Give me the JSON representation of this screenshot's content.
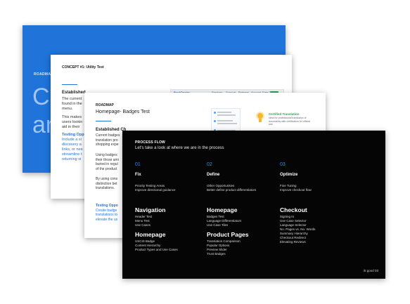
{
  "slide1": {
    "label": "ROADMAP",
    "big_line1": "Cu",
    "big_line2": "an"
  },
  "slide2": {
    "title": "CONCEPT #1: Utility Test",
    "heading": "Established",
    "para1": [
      "The current",
      "found in the",
      "menu."
    ],
    "para2": [
      "This makes",
      "users lookin",
      "aid in their"
    ],
    "testing_label": "Testing Opp",
    "testing_lines": [
      "Include a si",
      "discovery a",
      "links, or nee",
      "streamline t",
      "returning vi"
    ],
    "nav": {
      "logo": "BookDoctor",
      "items": [
        "Services",
        "Support",
        "Partners",
        "Account"
      ],
      "quote": "Free Quote"
    }
  },
  "slide3": {
    "label": "ROADMAP",
    "title": "Homepage- Badges Test",
    "heading": "Established Ch",
    "para1": [
      "Current badges",
      "translation pro",
      "shopping expe"
    ],
    "para2": [
      "Using badges",
      "their those ami",
      "buried in regul",
      "of the product"
    ],
    "para3": [
      "By using cons",
      "distinction bet",
      "translations."
    ],
    "testing_label": "Testing Oppo",
    "testing_lines": [
      "Create badge",
      "translations to",
      "elevate the us"
    ],
    "cert_title": "Certified Translation",
    "cert_desc": "Ideal for professional translation of documents with certification for official use."
  },
  "slide4": {
    "label": "PROCESS FLOW",
    "subtitle": "Let's take a look at where we are in the process",
    "columns": [
      {
        "num": "01",
        "title": "Fix",
        "lines": [
          "Priority Testing Areas",
          "Improve directional guidance"
        ],
        "sections": [
          {
            "heading": "Navigation",
            "items": [
              "Header Test",
              "Menu Test",
              "Use Cases"
            ]
          },
          {
            "heading": "Homepage",
            "items": [
              "USCIS Badge",
              "Content Hierarchy",
              "Product Types and Use Cases"
            ]
          }
        ]
      },
      {
        "num": "02",
        "title": "Define",
        "lines": [
          "Other Opportunities",
          "Better define product differentiators"
        ],
        "sections": [
          {
            "heading": "Homepage",
            "items": [
              "Badges Test",
              "Language Differentiators",
              "Use Case Tiles"
            ]
          },
          {
            "heading": "Product Pages",
            "items": [
              "Translation Comparison",
              "Popular Options",
              "Preview Slider",
              "Trust Badges"
            ]
          }
        ]
      },
      {
        "num": "03",
        "title": "Optimize",
        "lines": [
          "Fine Tuning",
          "Improve checkout flow"
        ],
        "sections": [
          {
            "heading": "Checkout",
            "items": [
              "Signing In",
              "Use Case Selector",
              "Language Selector",
              "No. Pages vs. No. Words",
              "Summary Hierarchy",
              "Checkout Redirect",
              "Elevating Reviews"
            ]
          }
        ]
      }
    ],
    "footer": "itr.good   03"
  }
}
